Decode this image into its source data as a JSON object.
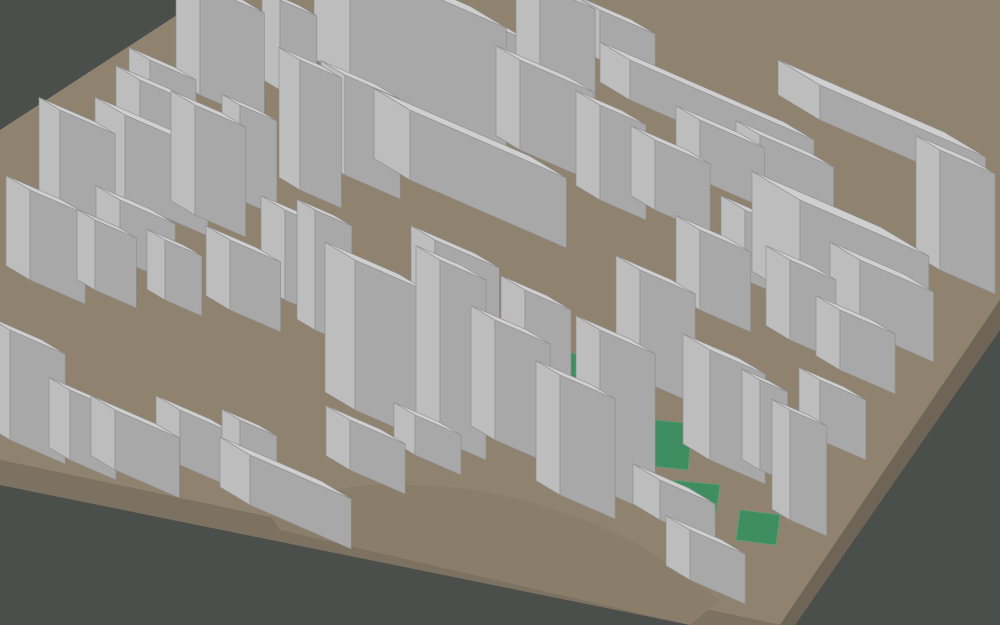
{
  "viewer": {
    "background_color": "#4b4f4b",
    "ground_color": "#8f8370",
    "ground_side_color": "#7d7262",
    "building_colors": {
      "top": "#cfcfcf",
      "left": "#bdbdbd",
      "right": "#a8a8a8",
      "shadow": "#979797"
    },
    "park_color": "#3e8e62",
    "park_highlight": "#56a97a"
  }
}
